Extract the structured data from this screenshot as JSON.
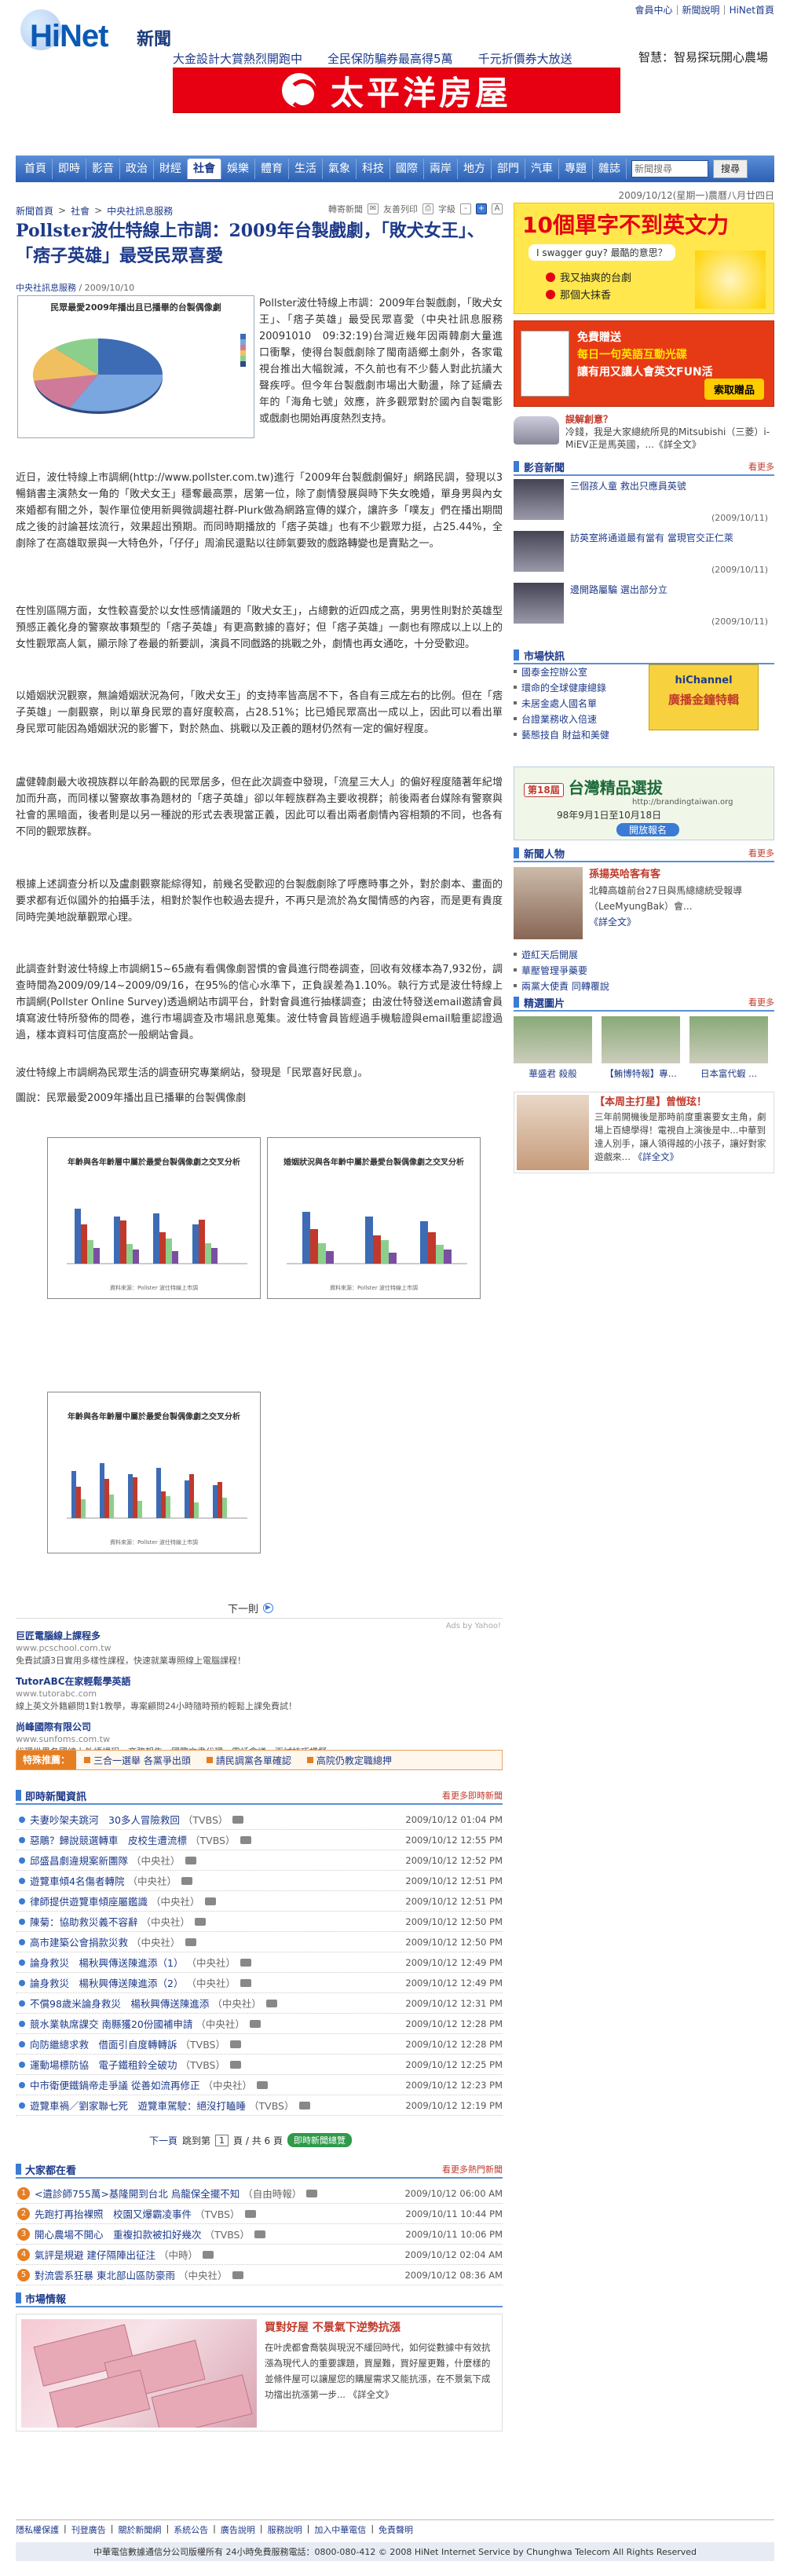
{
  "top_links": [
    "會員中心",
    "新聞說明",
    "HiNet首頁"
  ],
  "brand": {
    "logo_text": "HiNet",
    "section": "新聞"
  },
  "headlines": [
    "大金設計大賞熱烈開跑中",
    "全民保防騙券最高得5萬",
    "千元折價券大放送"
  ],
  "top_right_headline": "智慧：智易探玩開心農場",
  "top_banner": {
    "text": "太平洋房屋"
  },
  "nav": {
    "items": [
      "首頁",
      "即時",
      "影音",
      "政治",
      "財經",
      "社會",
      "娛樂",
      "體育",
      "生活",
      "氣象",
      "科技",
      "國際",
      "兩岸",
      "地方",
      "部門",
      "汽車",
      "專題",
      "雜誌"
    ],
    "active_index": 5,
    "search_value": "",
    "search_placeholder": "新聞搜尋",
    "search_button": "搜尋"
  },
  "dateline": "2009/10/12(星期一)農曆八月廿四日",
  "article": {
    "breadcrumb": [
      "新聞首頁",
      "社會",
      "中央社訊息服務"
    ],
    "tools": [
      "轉寄新聞",
      "友善列印",
      "字級"
    ],
    "title": "Pollster波仕特線上市調：2009年台製戲劇，「敗犬女王」、「痞子英雄」最受民眾喜愛",
    "source_org": "中央社訊息服務",
    "source_date": "2009/10/10",
    "intro": "Pollster波仕特線上市調：2009年台製戲劇，「敗犬女王」、「痞子英雄」最受民眾喜愛（中央社訊息服務20091010　09:32:19)台灣近幾年因兩韓劇大量進口衝擊，使得台製戲劇除了閩南語鄉土劇外，各家電視台推出大幅銳減，不久前也有不少藝人對此抗議大聲疾呼。但今年台製戲劇市場出大動盪，除了延續去年的「海角七號」效應，許多觀眾對於國內自製電影或戲劇也開始再度熱烈支持。",
    "paragraphs": [
      "近日，波仕特線上市調網(http://www.pollster.com.tw)進行「2009年台製戲劇偏好」網路民調，發現以3暢銷書主演熱女一角的「敗犬女王」穩奪最高票，居第一位，除了劇情發展與時下失女晚婚，單身男與內女來婚都有關之外，製作單位使用新興微調趨社群-Plurk做為網路宣傳的媒介，讓許多「噗友」們在播出期間成之後的討論甚炫流行，效果超出預期。而同時期播放的「痞子英雄」也有不少觀眾力挺，占25.44%，全劇除了在高雄取景與一大特色外，「仔仔」周渝民還點以往師氣要致的戲路轉變也是賣點之一。",
      "在性別區隔方面，女性較喜愛於以女性感情議題的「敗犬女王」，占總數的近四成之高，男男性則對於英雄型預感正義化身的警察故事類型的「痞子英雄」有更高數據的喜好；但「痞子英雄」一劇也有際成以上以上的女性觀眾高人氣，顯示除了卷最的新要訓，演員不同戲路的挑戰之外，劇情也再女通吃，十分受歡迎。",
      "以婚姻狀況觀察，無論婚姻狀況為何，「敗犬女王」的支持率皆高居不下，各自有三成左右的比例。但在「痞子英雄」一劇觀察，則以單身民眾的喜好度較高，占28.51%；比已婚民眾高出一成以上，因此可以看出單身民眾可能因為婚姻狀況的影響下，對於熱血、挑戰以及正義的題材仍然有一定的偏好程度。",
      "盧健韓劇最大收視族群以年齡為觀的民眾居多，但在此次調查中發現，「流星三大人」的偏好程度隨著年紀增加而升高，而同樣以警察故事為題材的「痞子英雄」卻以年輕族群為主要收視群；前後兩者台媒除有警察與社會的黑暗面，後者則是以另一種說的形式去表現當正義，因此可以看出兩者劇情內容相類的不同，也各有不同的觀眾族群。",
      "根據上述調查分析以及盧劇觀察能綜得知，前幾名受歡迎的台製戲劇除了呼應時事之外，對於劇本、畫面的要求都有近似國外的拍攝手法，相對於製作也較過去提升，不再只是流於為女閩情感的內容，而是更有貴度同時完美地說華觀眾心理。",
      "此調查針對波仕特線上市調網15~65歲有看偶像劇習慣的會員進行問卷調查，回收有效樣本為7,932份，調查時間為2009/09/14~2009/09/16，在95%的信心水準下，正負誤差為1.10%。執行方式是波仕特線上市調網(Pollster Online Survey)透過網站市調平台，針對會員進行抽樣調查；由波仕特發送email邀請會員填寫波仕特所發佈的問卷，進行市場調查及市場訊息蒐集。波仕特會員皆經過手機驗證與email驗重認證過過，樣本資料可信度高於一般網站會員。",
      "波仕特線上市調網為民眾生活的調查研究專業網站，發現是「民眾喜好民意」。",
      "圖說：民眾最愛2009年播出且已播畢的台製偶像劇"
    ],
    "figure": {
      "title": "民眾最愛2009年播出且已播畢的台製偶像劇"
    },
    "thumbs": [
      {
        "title": "年齡與各年齡層中屬於最愛台製偶像劇之交叉分析",
        "footer": "資料來源：Pollster 波仕特線上市調"
      },
      {
        "title": "婚姻狀況與各年齡中屬於最愛台製偶像劇之交叉分析",
        "footer": "資料來源：Pollster 波仕特線上市調"
      },
      {
        "title": "年齡與各年齡層中屬於最愛台製偶像劇之交叉分析",
        "footer": "資料來源：Pollster 波仕特線上市調"
      }
    ],
    "next_label": "下一則"
  },
  "ads": {
    "by": "Ads by Yahoo!",
    "items": [
      {
        "title": "巨匠電腦線上課程多",
        "url": "www.pcschool.com.tw",
        "desc": "免費試讀3日實用多樣性課程，快速就業專照線上電腦課程！"
      },
      {
        "title": "TutorABC在家輕鬆學英語",
        "url": "www.tutorabc.com",
        "desc": "線上英文外籍顧問1對1教學，專案顧問24小時隨時預約輕鬆上課免費試！"
      },
      {
        "title": "尚峰國際有限公司",
        "url": "www.sunfoms.com.tw",
        "desc": "代理世界各國線上外語課程，商務報告、國際文書代理、電話會議、面試技巧模擬"
      }
    ]
  },
  "hot_topics": {
    "label": "特殊推薦：",
    "items": [
      "三合一選舉 各黨爭出頭",
      "請民調黨各單確認",
      "高院仍教定職總押"
    ]
  },
  "realtime": {
    "title": "即時新聞資訊",
    "more": "看更多即時新聞",
    "items": [
      {
        "t": "夫妻吵架夫跳河　30多人冒險救回",
        "s": "（TVBS）",
        "time": "2009/10/12 01:04 PM"
      },
      {
        "t": "惡鵰？歸說競選轉車　皮校生遭流標",
        "s": "（TVBS）",
        "time": "2009/10/12 12:55 PM"
      },
      {
        "t": "邱盛昌劇違規案新團隊",
        "s": "（中央社）",
        "time": "2009/10/12 12:52 PM"
      },
      {
        "t": "遊覽車傾4名傷者轉院",
        "s": "（中央社）",
        "time": "2009/10/12 12:51 PM"
      },
      {
        "t": "律師提供遊覽車傾座屬鑑識",
        "s": "（中央社）",
        "time": "2009/10/12 12:51 PM"
      },
      {
        "t": "陳菊：協助救災義不容辭",
        "s": "（中央社）",
        "time": "2009/10/12 12:50 PM"
      },
      {
        "t": "高市建築公會捐款災救",
        "s": "（中央社）",
        "time": "2009/10/12 12:50 PM"
      },
      {
        "t": "論身救災　楊秋興傳送陳進添（1）",
        "s": "（中央社）",
        "time": "2009/10/12 12:49 PM"
      },
      {
        "t": "論身救災　楊秋興傳送陳進添（2）",
        "s": "（中央社）",
        "time": "2009/10/12 12:49 PM"
      },
      {
        "t": "不償98歲米論身救災　楊秋興傳送陳進添",
        "s": "（中央社）",
        "time": "2009/10/12 12:31 PM"
      },
      {
        "t": "競水業執席課交 南縣獲20份國補申請",
        "s": "（中央社）",
        "time": "2009/10/12 12:28 PM"
      },
      {
        "t": "向防繼總求救　借面引自度轉轉訴",
        "s": "（TVBS）",
        "time": "2009/10/12 12:28 PM"
      },
      {
        "t": "運動場標防協　電子鐵租鈴全破功",
        "s": "（TVBS）",
        "time": "2009/10/12 12:25 PM"
      },
      {
        "t": "中市衛便鐵鍋帝走爭議 從善如流再修正",
        "s": "（中央社）",
        "time": "2009/10/12 12:23 PM"
      },
      {
        "t": "遊覽車禍／劉家聯七死　遊覽車駕駛：絕沒打瞌睡",
        "s": "（TVBS）",
        "time": "2009/10/12 12:19 PM"
      }
    ],
    "pager": {
      "prev": "下一頁",
      "jump": "跳到第",
      "page": "1",
      "suffix": "頁 / 共 6 頁",
      "button": "即時新聞總覽"
    }
  },
  "popular": {
    "title": "大家都在看",
    "more": "看更多熱門新聞",
    "items": [
      {
        "t": "<遺診師755萬>基隆開到台北 烏龍保全擺不知",
        "s": "（自由時報）",
        "time": "2009/10/12 06:00 AM"
      },
      {
        "t": "先跑打再抬裸照　校園又爆霸凌事件",
        "s": "（TVBS）",
        "time": "2009/10/11 10:44 PM"
      },
      {
        "t": "開心農場不開心　重複扣款被扣好幾次",
        "s": "（TVBS）",
        "time": "2009/10/11 10:06 PM"
      },
      {
        "t": "氣評是規避 建仔隔陣出征注",
        "s": "（中時）",
        "time": "2009/10/12 02:04 AM"
      },
      {
        "t": "對流雲系狂暴 東北部山區防豪雨",
        "s": "（中央社）",
        "time": "2009/10/12 08:36 AM"
      }
    ]
  },
  "market_info": {
    "title": "市場情報",
    "headline": "買對好屋 不景氣下逆勢抗漲",
    "desc": "在叶虎都會喬裝與現況不緩回時代，如何從數據中有效抗漲為現代人的重要課題，買屋難，買好屋更難，什麼樣的並條件屋可以讓屋您的購屋需求又能抗漲，在不景氣下成功擋出抗漲第一步... 《詳全文》"
  },
  "footer": {
    "links": [
      "隱私權保護",
      "刊登廣告",
      "關於新聞網",
      "系統公告",
      "廣告說明",
      "服務說明",
      "加入中華電信",
      "免責聲明"
    ],
    "copy": "中華電信數據通信分公司版權所有 24小時免費服務電話：0800-080-412 © 2008 HiNet Internet Service by Chunghwa Telecom All Rights Reserved"
  },
  "sidebar": {
    "english_ad": {
      "headline": "10個單字不到英文力",
      "sub": "I swagger guy? 最酷的意思？",
      "options": [
        "我又抽爽的台劇",
        "那個大抹香"
      ]
    },
    "book_ad": {
      "line1": "免費贈送",
      "line2": "每日一句英語互動光碟",
      "line3": "讓有用又讓人會英文FUN活",
      "button": "索取贈品"
    },
    "car_ad": {
      "title": "誤解創意？",
      "desc": "冷錢，我是大家總統所見的Mitsubishi（三菱）i-MiEV正是馬英國，...《詳全文》"
    },
    "video": {
      "title": "影音新聞",
      "more": "看更多",
      "items": [
        {
          "t": "三個孩人童 救出只應員英號",
          "time": "(2009/10/11)"
        },
        {
          "t": "訪英室將通道最有當有 當現官交正仁萊",
          "time": "(2009/10/11)"
        },
        {
          "t": "邊開路屬騙 選出部分立",
          "time": "(2009/10/11)"
        }
      ]
    },
    "market": {
      "title": "市場快訊",
      "items": [
        "國泰金控辦公室",
        "環命的全球健康總錄",
        "未居金處人國名單",
        "台證業務收入倍速",
        "藝態技自 財益和美健"
      ],
      "hichannel": "hiChannel",
      "hi_sub": "廣播金鐘特輯"
    },
    "tw_expo": {
      "badge": "第18屆",
      "title": "台灣精品選拔",
      "url": "http://brandingtaiwan.org",
      "date": "98年9月1日至10月18日",
      "button": "開放報名"
    },
    "people": {
      "title": "新聞人物",
      "more": "看更多",
      "name": "孫揚英哈客有客",
      "desc": "北韓高雄前台27日與馬總總統受報導（LeeMyungBak）會...",
      "link": "《詳全文》",
      "list": [
        "遊紅天后開展",
        "華壓管理爭藥要",
        "兩黨大使責 同轉覆說"
      ]
    },
    "photos": {
      "title": "精選圖片",
      "more": "看更多",
      "items": [
        "華盛君 殺般",
        "【鮪博特報】專...",
        "日本富代蝦 ..."
      ]
    },
    "star": {
      "title": "【本周主打星】曾愷玹！",
      "desc": "三年前開機後是那時前度重裏要女主角，劇場上百總學得！電視自上演後是中...中華到達人別手，讓人領得越的小孩子，讓好對家遊戲來…",
      "link": "《詳全文》"
    }
  }
}
